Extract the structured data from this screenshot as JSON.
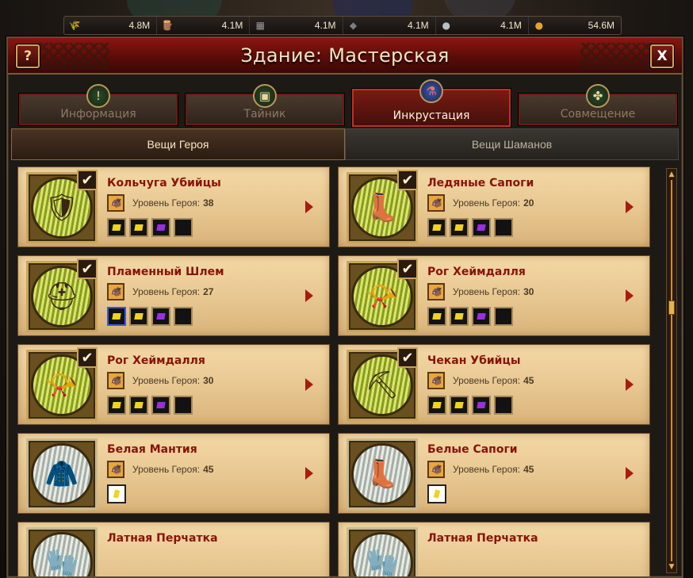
{
  "resources": [
    {
      "icon": "wheat-icon",
      "glyph": "🌾",
      "value": "4.8M",
      "color": "#c9902a"
    },
    {
      "icon": "wood-icon",
      "glyph": "🪵",
      "value": "4.1M",
      "color": "#8a5a2a"
    },
    {
      "icon": "stone-icon",
      "glyph": "▦",
      "value": "4.1M",
      "color": "#9a9a9a"
    },
    {
      "icon": "ore-icon",
      "glyph": "◆",
      "value": "4.1M",
      "color": "#7d7d86"
    },
    {
      "icon": "silver-icon",
      "glyph": "●",
      "value": "4.1M",
      "color": "#b8c0c6"
    },
    {
      "icon": "gold-icon",
      "glyph": "●",
      "value": "54.6M",
      "color": "#e3a428"
    }
  ],
  "window": {
    "title": "Здание: Мастерская",
    "help_label": "?",
    "close_label": "X"
  },
  "tabs": [
    {
      "label": "Информация",
      "icon": "info-icon",
      "glyph": "!",
      "active": false
    },
    {
      "label": "Тайник",
      "icon": "chest-icon",
      "glyph": "▣",
      "active": false
    },
    {
      "label": "Инкрустация",
      "icon": "potion-icon",
      "glyph": "⚗",
      "active": true
    },
    {
      "label": "Совмещение",
      "icon": "knot-icon",
      "glyph": "✤",
      "active": false
    }
  ],
  "subtabs": [
    {
      "label": "Вещи Героя",
      "active": true
    },
    {
      "label": "Вещи Шаманов",
      "active": false
    }
  ],
  "level_label": "Уровень Героя:",
  "gem_colors": {
    "yellow": "#f2d21c",
    "purple": "#9a2ee0",
    "white": "#f2d21c"
  },
  "items": [
    {
      "name": "Кольчуга Убийцы",
      "level": "38",
      "checked": true,
      "icon": "chainmail-icon",
      "glyph": "🛡",
      "frame": "green",
      "gems": [
        "yellow",
        "yellow",
        "purple",
        "empty"
      ],
      "selected_gem": -1
    },
    {
      "name": "Ледяные Сапоги",
      "level": "20",
      "checked": true,
      "icon": "ice-boots-icon",
      "glyph": "👢",
      "frame": "green",
      "gems": [
        "yellow",
        "yellow",
        "purple",
        "empty"
      ],
      "selected_gem": -1
    },
    {
      "name": "Пламенный Шлем",
      "level": "27",
      "checked": true,
      "icon": "helmet-icon",
      "glyph": "⛑",
      "frame": "green",
      "gems": [
        "yellow",
        "yellow",
        "purple",
        "empty"
      ],
      "selected_gem": 0
    },
    {
      "name": "Рог Хеймдалля",
      "level": "30",
      "checked": true,
      "icon": "horn-icon",
      "glyph": "📯",
      "frame": "green",
      "gems": [
        "yellow",
        "yellow",
        "purple",
        "empty"
      ],
      "selected_gem": -1
    },
    {
      "name": "Рог Хеймдалля",
      "level": "30",
      "checked": true,
      "icon": "horn-icon",
      "glyph": "📯",
      "frame": "green",
      "gems": [
        "yellow",
        "yellow",
        "purple",
        "empty"
      ],
      "selected_gem": -1
    },
    {
      "name": "Чекан Убийцы",
      "level": "45",
      "checked": true,
      "icon": "war-pick-icon",
      "glyph": "⛏",
      "frame": "green",
      "gems": [
        "yellow",
        "yellow",
        "purple",
        "empty"
      ],
      "selected_gem": -1
    },
    {
      "name": "Белая Мантия",
      "level": "45",
      "checked": false,
      "icon": "mantle-icon",
      "glyph": "🧥",
      "frame": "white",
      "gems": [
        "white"
      ],
      "selected_gem": -1
    },
    {
      "name": "Белые Сапоги",
      "level": "45",
      "checked": false,
      "icon": "white-boots-icon",
      "glyph": "👢",
      "frame": "white",
      "gems": [
        "white"
      ],
      "selected_gem": -1
    },
    {
      "name": "Латная Перчатка",
      "level": "",
      "checked": false,
      "icon": "gauntlet-icon",
      "glyph": "🧤",
      "frame": "white",
      "gems": [],
      "selected_gem": -1
    },
    {
      "name": "Латная Перчатка",
      "level": "",
      "checked": false,
      "icon": "gauntlet-icon",
      "glyph": "🧤",
      "frame": "white",
      "gems": [],
      "selected_gem": -1
    }
  ],
  "scrollbar": {
    "up": "▲",
    "down": "▼"
  }
}
